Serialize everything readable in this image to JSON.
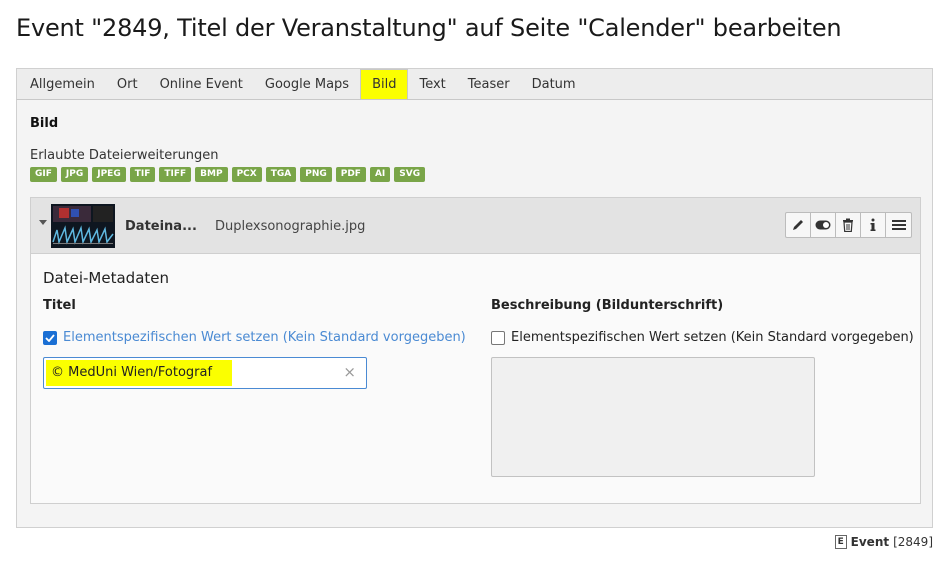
{
  "page_title": "Event \"2849, Titel der Veranstaltung\" auf Seite \"Calender\" bearbeiten",
  "tabs": [
    {
      "label": "Allgemein",
      "active": false
    },
    {
      "label": "Ort",
      "active": false
    },
    {
      "label": "Online Event",
      "active": false
    },
    {
      "label": "Google Maps",
      "active": false
    },
    {
      "label": "Bild",
      "active": true
    },
    {
      "label": "Text",
      "active": false
    },
    {
      "label": "Teaser",
      "active": false
    },
    {
      "label": "Datum",
      "active": false
    }
  ],
  "section": {
    "title": "Bild",
    "extensions_label": "Erlaubte Dateierweiterungen",
    "extensions": [
      "GIF",
      "JPG",
      "JPEG",
      "TIF",
      "TIFF",
      "BMP",
      "PCX",
      "TGA",
      "PNG",
      "PDF",
      "AI",
      "SVG"
    ]
  },
  "file": {
    "key_label": "Dateina...",
    "filename": "Duplexsonographie.jpg",
    "actions": [
      "pencil-icon",
      "toggle-icon",
      "trash-icon",
      "info-icon",
      "menu-icon"
    ]
  },
  "metadata": {
    "heading": "Datei-Metadaten",
    "title_label": "Titel",
    "title_checkbox_label": "Elementspezifischen Wert setzen (Kein Standard vorgegeben)",
    "title_checkbox_checked": true,
    "title_value": "© MedUni Wien/Fotograf",
    "description_label": "Beschreibung (Bildunterschrift)",
    "description_checkbox_label": "Elementspezifischen Wert setzen (Kein Standard vorgegeben)",
    "description_checkbox_checked": false,
    "description_value": ""
  },
  "footer": {
    "record_icon": "E",
    "record_type": "Event",
    "record_id": "[2849]"
  },
  "colors": {
    "highlight": "#fbff00",
    "badge_green": "#79a548",
    "link_blue": "#4a8ad3",
    "checkbox_blue": "#1a6fd4"
  }
}
